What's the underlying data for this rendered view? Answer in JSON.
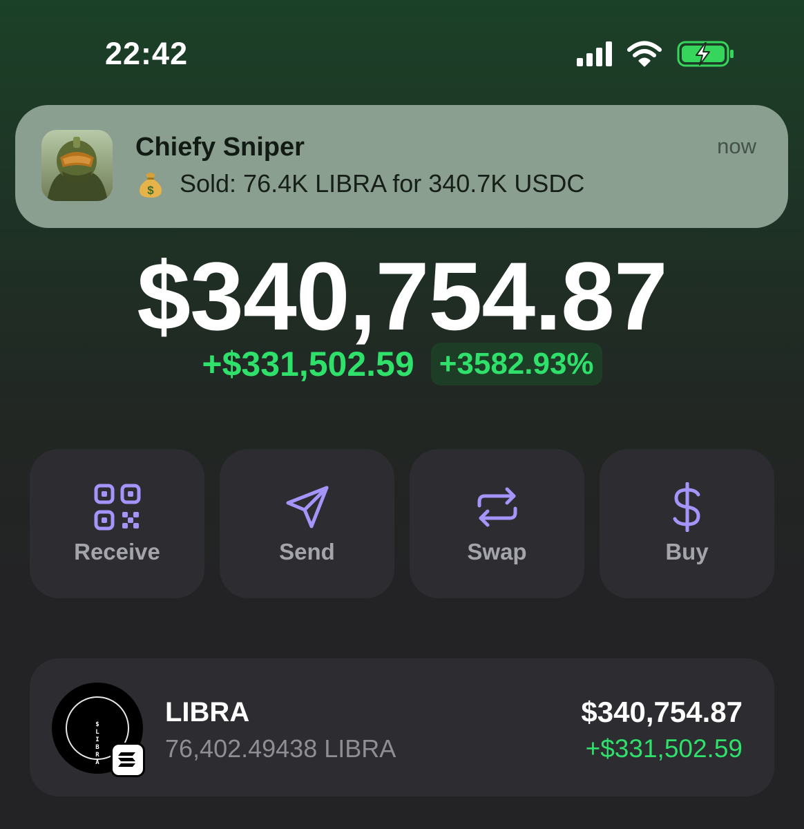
{
  "status_bar": {
    "time": "22:42",
    "icons": [
      "cellular-signal-icon",
      "wifi-icon",
      "battery-charging-icon"
    ]
  },
  "notification": {
    "app_icon": "chiefy-sniper-app-icon",
    "title": "Chiefy Sniper",
    "emoji": "money-bag-icon",
    "message": "Sold: 76.4K LIBRA for 340.7K USDC",
    "time": "now"
  },
  "balance": {
    "total": "$340,754.87",
    "change_amount": "+$331,502.59",
    "change_percent": "+3582.93%"
  },
  "actions": [
    {
      "label": "Receive",
      "icon": "qr-code-icon"
    },
    {
      "label": "Send",
      "icon": "send-icon"
    },
    {
      "label": "Swap",
      "icon": "swap-icon"
    },
    {
      "label": "Buy",
      "icon": "dollar-icon"
    }
  ],
  "token": {
    "name": "LIBRA",
    "logo_text": "$ LIBRA",
    "amount": "76,402.49438 LIBRA",
    "value": "$340,754.87",
    "change": "+$331,502.59",
    "chain_badge": "solana-icon"
  },
  "colors": {
    "positive": "#2fe06a",
    "accent_icon": "#a594f9",
    "card_background": "#2c2c31",
    "notification_background": "#8a9f8f"
  }
}
